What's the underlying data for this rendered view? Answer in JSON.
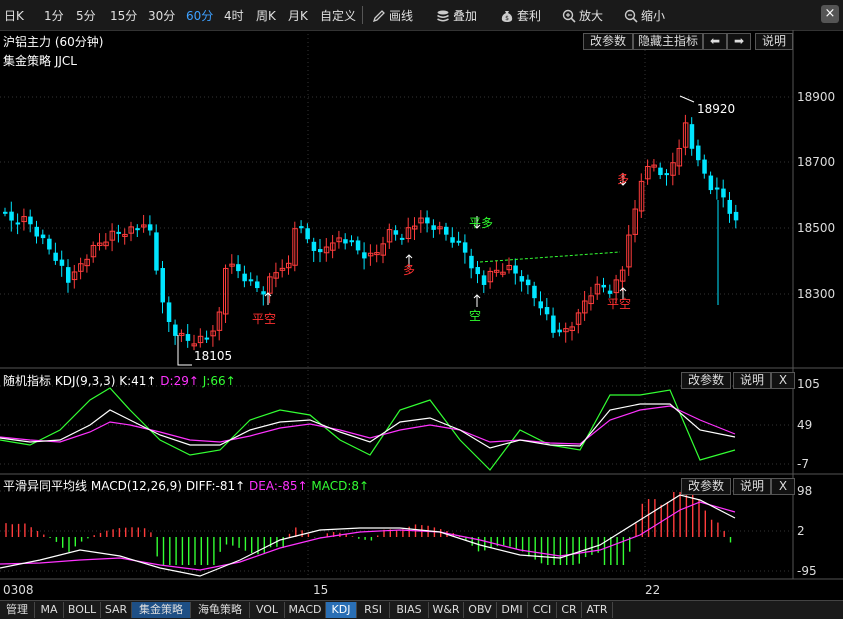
{
  "toolbar": {
    "periods": [
      {
        "label": "日K",
        "active": false
      },
      {
        "label": "1分",
        "active": false
      },
      {
        "label": "5分",
        "active": false
      },
      {
        "label": "15分",
        "active": false
      },
      {
        "label": "30分",
        "active": false
      },
      {
        "label": "60分",
        "active": true
      },
      {
        "label": "4时",
        "active": false
      },
      {
        "label": "周K",
        "active": false
      },
      {
        "label": "月K",
        "active": false
      },
      {
        "label": "自定义",
        "active": false
      }
    ],
    "tools": [
      {
        "label": "画线",
        "icon": "pencil-icon"
      },
      {
        "label": "叠加",
        "icon": "stack-icon"
      },
      {
        "label": "套利",
        "icon": "money-bag-icon"
      },
      {
        "label": "放大",
        "icon": "zoom-in-icon"
      },
      {
        "label": "缩小",
        "icon": "zoom-out-icon"
      }
    ],
    "close_label": "×"
  },
  "main_panel": {
    "title": "沪铝主力 (60分钟)",
    "strategy": "集金策略 JJCL",
    "buttons": {
      "modify": "改参数",
      "hide": "隐藏主指标",
      "left": "⬅",
      "right": "➡",
      "help": "说明"
    },
    "y_ticks": [
      "18900",
      "18700",
      "18500",
      "18300"
    ],
    "annotations": {
      "high": "18920",
      "low": "18105"
    },
    "signals": [
      {
        "text": "平空",
        "color": "#ff3030"
      },
      {
        "text": "多",
        "color": "#ff3030"
      },
      {
        "text": "平多",
        "color": "#30ff30"
      },
      {
        "text": "空",
        "color": "#30ff30"
      },
      {
        "text": "多",
        "color": "#ff3030"
      },
      {
        "text": "平空",
        "color": "#ff3030"
      }
    ]
  },
  "kdj_panel": {
    "name": "随机指标",
    "params": "KDJ(9,3,3)",
    "k": "K:41↑",
    "d": "D:29↑",
    "j": "J:66↑",
    "colors": {
      "k": "#ffffff",
      "d": "#ff33ff",
      "j": "#33ff33"
    },
    "buttons": {
      "modify": "改参数",
      "help": "说明",
      "close": "X"
    },
    "y_ticks": [
      "105",
      "49",
      "-7"
    ]
  },
  "macd_panel": {
    "name": "平滑异同平均线",
    "params": "MACD(12,26,9)",
    "diff": "DIFF:-81↑",
    "dea": "DEA:-85↑",
    "macd": "MACD:8↑",
    "colors": {
      "diff": "#ffffff",
      "dea": "#ff33ff",
      "macd": "#33ff33"
    },
    "buttons": {
      "modify": "改参数",
      "help": "说明",
      "close": "X"
    },
    "y_ticks": [
      "98",
      "2",
      "-95"
    ]
  },
  "x_axis": {
    "labels": [
      "0308",
      "15",
      "22"
    ]
  },
  "bottom_tabs": [
    {
      "label": "管理",
      "active": false
    },
    {
      "label": "MA",
      "active": false
    },
    {
      "label": "BOLL",
      "active": false
    },
    {
      "label": "SAR",
      "active": false
    },
    {
      "label": "集金策略",
      "active": false
    },
    {
      "label": "海龟策略",
      "active": false
    },
    {
      "label": "VOL",
      "active": false
    },
    {
      "label": "MACD",
      "active": false
    },
    {
      "label": "KDJ",
      "active": true
    },
    {
      "label": "RSI",
      "active": false
    },
    {
      "label": "BIAS",
      "active": false
    },
    {
      "label": "W&R",
      "active": false
    },
    {
      "label": "OBV",
      "active": false
    },
    {
      "label": "DMI",
      "active": false
    },
    {
      "label": "CCI",
      "active": false
    },
    {
      "label": "CR",
      "active": false
    },
    {
      "label": "ATR",
      "active": false
    }
  ]
}
